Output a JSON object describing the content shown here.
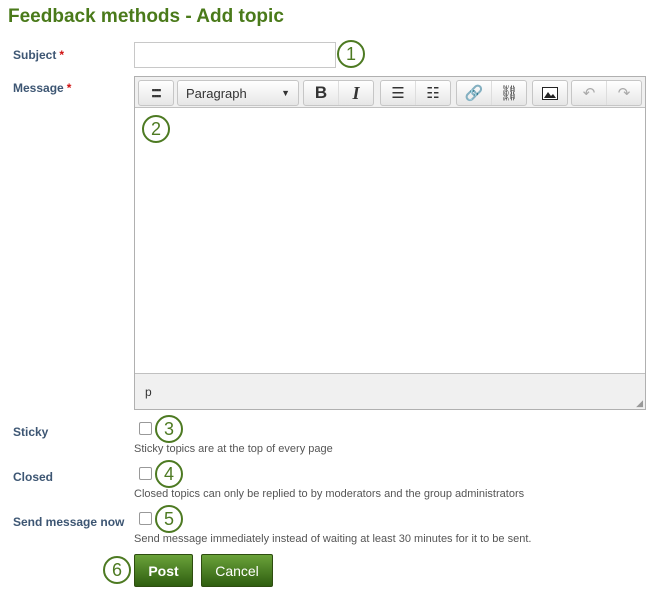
{
  "title": "Feedback methods - Add topic",
  "fields": {
    "subject": {
      "label": "Subject",
      "required_mark": "*",
      "value": "",
      "callout": "1"
    },
    "message": {
      "label": "Message",
      "required_mark": "*",
      "callout": "2",
      "format": "Paragraph",
      "status_path": "p"
    },
    "sticky": {
      "label": "Sticky",
      "checked": false,
      "help": "Sticky topics are at the top of every page",
      "callout": "3"
    },
    "closed": {
      "label": "Closed",
      "checked": false,
      "help": "Closed topics can only be replied to by moderators and the group administrators",
      "callout": "4"
    },
    "send_now": {
      "label": "Send message now",
      "checked": false,
      "help": "Send message immediately instead of waiting at least 30 minutes for it to be sent.",
      "callout": "5"
    }
  },
  "toolbar": {
    "icons": [
      "toolbar-toggle-icon",
      "bold-icon",
      "italic-icon",
      "bullet-list-icon",
      "numbered-list-icon",
      "link-icon",
      "unlink-icon",
      "image-icon",
      "undo-icon",
      "redo-icon"
    ],
    "bold": "B",
    "italic": "I"
  },
  "buttons": {
    "post": "Post",
    "cancel": "Cancel",
    "callout": "6"
  },
  "colors": {
    "title": "#4a7a1a",
    "label": "#3d5673",
    "button": "#3f7118",
    "callout": "#4d7a22"
  }
}
